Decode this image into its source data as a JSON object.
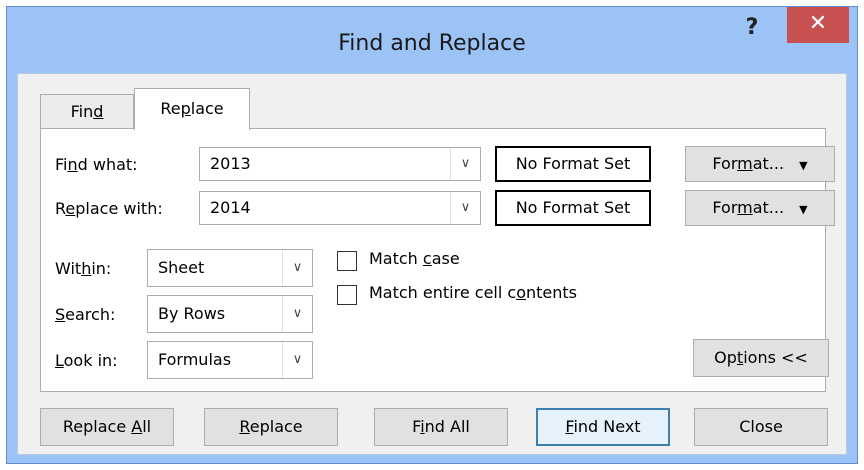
{
  "dialog": {
    "title": "Find and Replace",
    "help_label": "?",
    "close_label": "✕"
  },
  "tabs": [
    {
      "label_pre": "Fin",
      "label_u": "d",
      "label_post": ""
    },
    {
      "label_pre": "Re",
      "label_u": "p",
      "label_post": "lace"
    }
  ],
  "find": {
    "label_pre": "Fi",
    "label_u": "n",
    "label_post": "d what:",
    "value": "2013",
    "format_status": "No Format Set",
    "format_pre": "For",
    "format_u": "m",
    "format_post": "at..."
  },
  "replace": {
    "label_pre": "R",
    "label_u": "e",
    "label_post": "place with:",
    "value": "2014",
    "format_status": "No Format Set",
    "format_pre": "For",
    "format_u": "m",
    "format_post": "at..."
  },
  "within": {
    "label_pre": "Wit",
    "label_u": "h",
    "label_post": "in:",
    "value": "Sheet"
  },
  "search": {
    "label_pre": "",
    "label_u": "S",
    "label_post": "earch:",
    "value": "By Rows"
  },
  "lookin": {
    "label_pre": "",
    "label_u": "L",
    "label_post": "ook in:",
    "value": "Formulas"
  },
  "match_case": {
    "label_pre": "Match ",
    "label_u": "c",
    "label_post": "ase",
    "checked": false
  },
  "match_entire": {
    "label_pre": "Match entire cell c",
    "label_u": "o",
    "label_post": "ntents",
    "checked": false
  },
  "options": {
    "label_pre": "Op",
    "label_u": "t",
    "label_post": "ions <<"
  },
  "buttons": {
    "replace_all": {
      "pre": "Replace ",
      "u": "A",
      "post": "ll"
    },
    "replace": {
      "pre": "",
      "u": "R",
      "post": "eplace"
    },
    "find_all": {
      "pre": "F",
      "u": "i",
      "post": "nd All"
    },
    "find_next": {
      "pre": "",
      "u": "F",
      "post": "ind Next"
    },
    "close": {
      "pre": "Close",
      "u": "",
      "post": ""
    }
  }
}
